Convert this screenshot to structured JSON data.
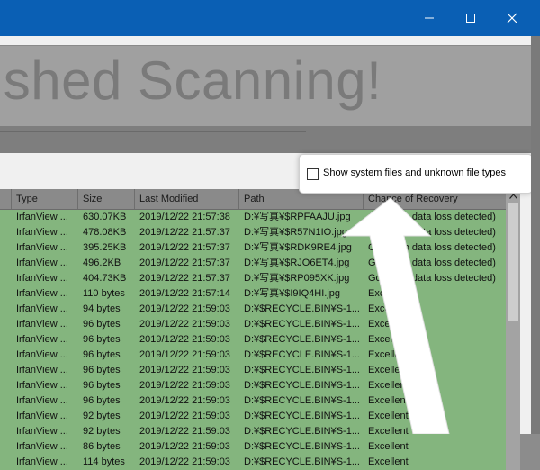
{
  "banner": {
    "text": "nished Scanning!"
  },
  "options": {
    "show_system_files_label": "Show system files and unknown file types"
  },
  "table": {
    "columns": [
      "Type",
      "Size",
      "Last Modified",
      "Path",
      "Chance of Recovery"
    ],
    "rows": [
      [
        "IrfanView ...",
        "630.07KB",
        "2019/12/22 21:57:38",
        "D:¥写真¥$RPFAAJU.jpg",
        "Good (no data loss detected)"
      ],
      [
        "IrfanView ...",
        "478.08KB",
        "2019/12/22 21:57:37",
        "D:¥写真¥$R57N1IO.jpg",
        "Good (no data loss detected)"
      ],
      [
        "IrfanView ...",
        "395.25KB",
        "2019/12/22 21:57:37",
        "D:¥写真¥$RDK9RE4.jpg",
        "Good (no data loss detected)"
      ],
      [
        "IrfanView ...",
        "496.2KB",
        "2019/12/22 21:57:37",
        "D:¥写真¥$RJO6ET4.jpg",
        "Good (no data loss detected)"
      ],
      [
        "IrfanView ...",
        "404.73KB",
        "2019/12/22 21:57:37",
        "D:¥写真¥$RP095XK.jpg",
        "Good (no data loss detected)"
      ],
      [
        "IrfanView ...",
        "110 bytes",
        "2019/12/22 21:57:14",
        "D:¥写真¥$I9IQ4HI.jpg",
        "Excellent"
      ],
      [
        "IrfanView ...",
        "94 bytes",
        "2019/12/22 21:59:03",
        "D:¥$RECYCLE.BIN¥S-1...",
        "Excellent"
      ],
      [
        "IrfanView ...",
        "96 bytes",
        "2019/12/22 21:59:03",
        "D:¥$RECYCLE.BIN¥S-1...",
        "Excellent"
      ],
      [
        "IrfanView ...",
        "96 bytes",
        "2019/12/22 21:59:03",
        "D:¥$RECYCLE.BIN¥S-1...",
        "Excellent"
      ],
      [
        "IrfanView ...",
        "96 bytes",
        "2019/12/22 21:59:03",
        "D:¥$RECYCLE.BIN¥S-1...",
        "Excellent"
      ],
      [
        "IrfanView ...",
        "96 bytes",
        "2019/12/22 21:59:03",
        "D:¥$RECYCLE.BIN¥S-1...",
        "Excellent"
      ],
      [
        "IrfanView ...",
        "96 bytes",
        "2019/12/22 21:59:03",
        "D:¥$RECYCLE.BIN¥S-1...",
        "Excellent"
      ],
      [
        "IrfanView ...",
        "96 bytes",
        "2019/12/22 21:59:03",
        "D:¥$RECYCLE.BIN¥S-1...",
        "Excellent"
      ],
      [
        "IrfanView ...",
        "92 bytes",
        "2019/12/22 21:59:03",
        "D:¥$RECYCLE.BIN¥S-1...",
        "Excellent"
      ],
      [
        "IrfanView ...",
        "92 bytes",
        "2019/12/22 21:59:03",
        "D:¥$RECYCLE.BIN¥S-1...",
        "Excellent"
      ],
      [
        "IrfanView ...",
        "86 bytes",
        "2019/12/22 21:59:03",
        "D:¥$RECYCLE.BIN¥S-1...",
        "Excellent"
      ],
      [
        "IrfanView ...",
        "114 bytes",
        "2019/12/22 21:59:03",
        "D:¥$RECYCLE.BIN¥S-1...",
        "Excellent"
      ]
    ]
  },
  "colors": {
    "titlebar": "#0a5fb4",
    "row_fill": "#84b57e",
    "banner_text": "#7a7a7a"
  }
}
